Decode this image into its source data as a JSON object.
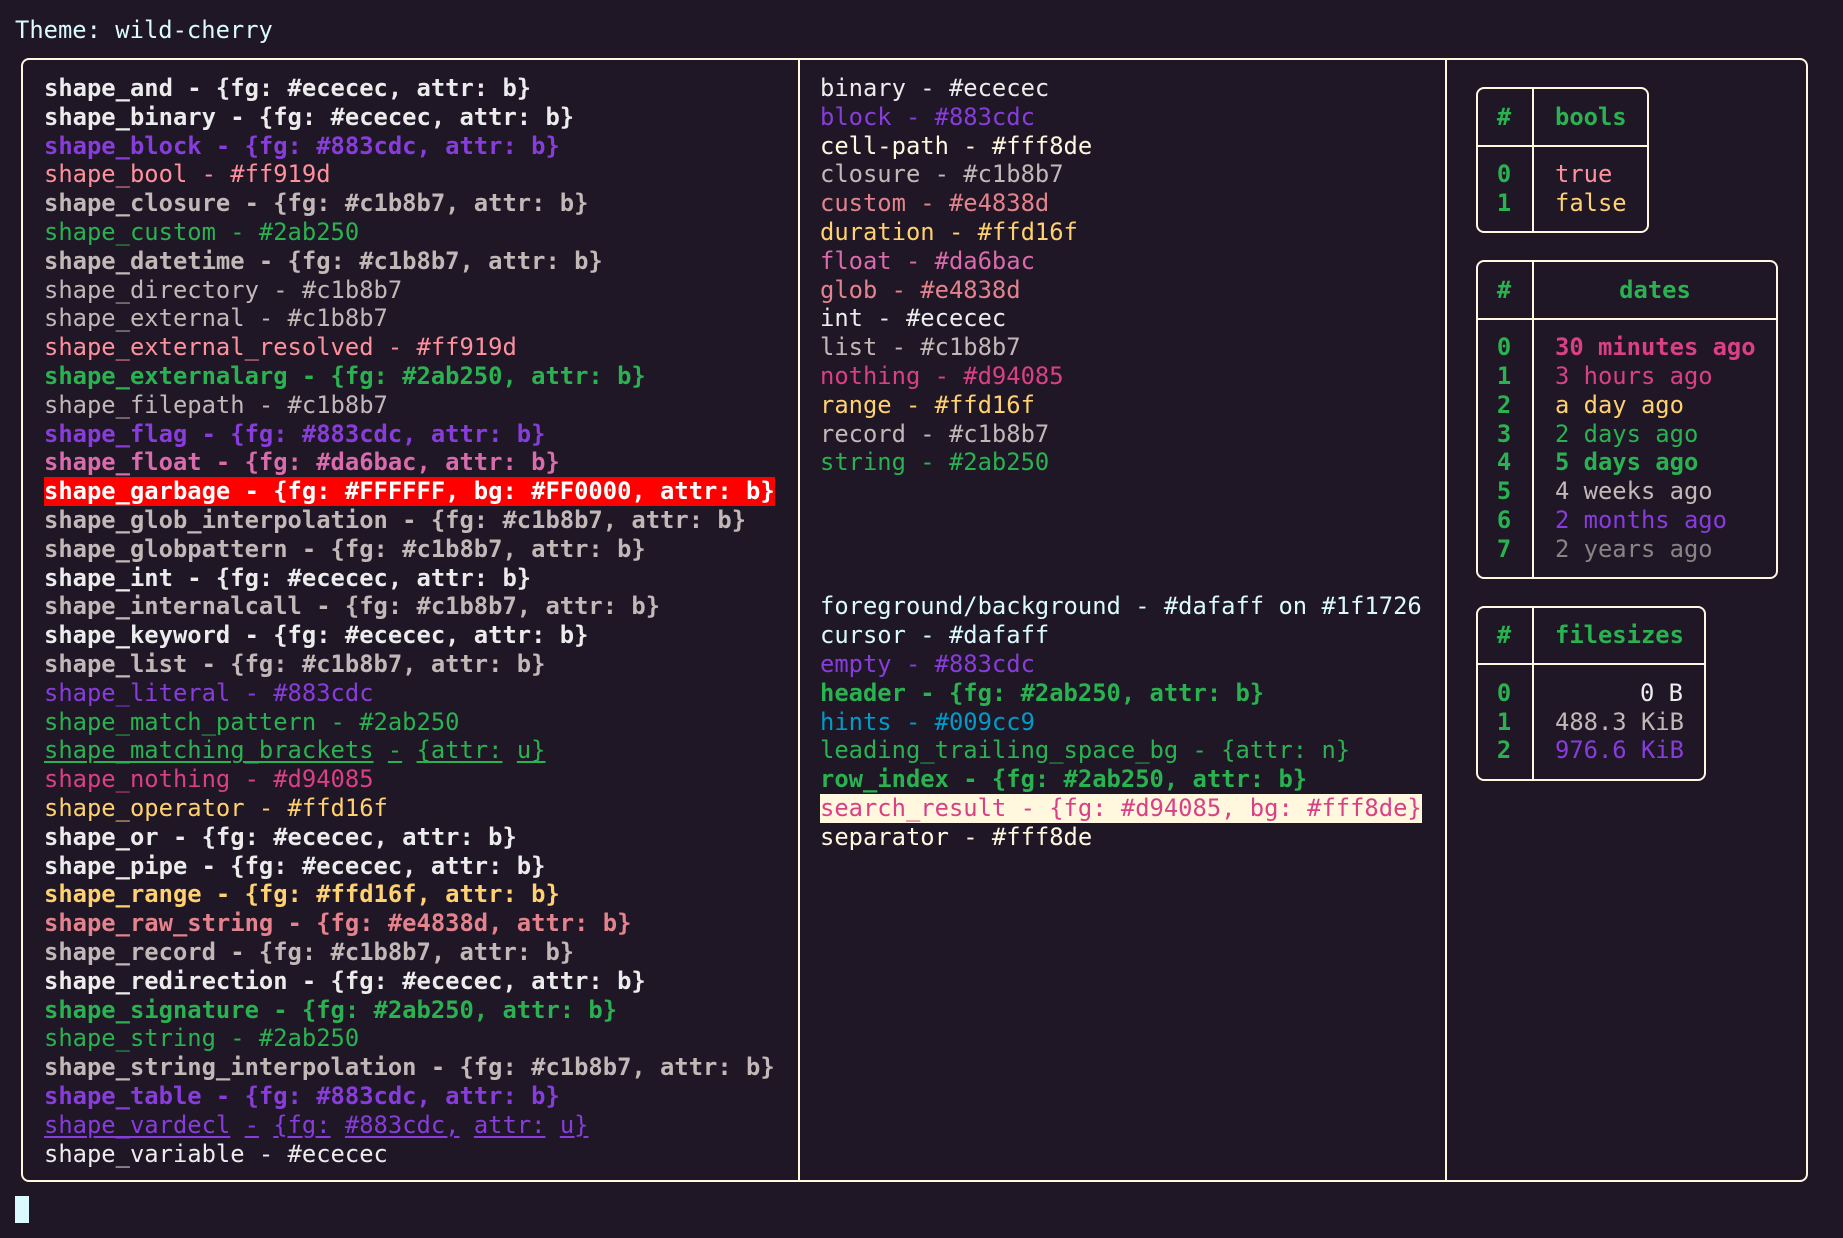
{
  "title": "Theme: wild-cherry",
  "colors": {
    "background": "#1f1726",
    "foreground": "#dafaff",
    "border": "#fff8de",
    "cursor": "#dafaff"
  },
  "shapes": [
    {
      "text": "shape_and - {fg: #ececec, attr: b}",
      "fg": "#ececec",
      "bold": true
    },
    {
      "text": "shape_binary - {fg: #ececec, attr: b}",
      "fg": "#ececec",
      "bold": true
    },
    {
      "text": "shape_block - {fg: #883cdc, attr: b}",
      "fg": "#883cdc",
      "bold": true
    },
    {
      "text": "shape_bool - #ff919d",
      "fg": "#ff919d"
    },
    {
      "text": "shape_closure - {fg: #c1b8b7, attr: b}",
      "fg": "#c1b8b7",
      "bold": true
    },
    {
      "text": "shape_custom - #2ab250",
      "fg": "#2ab250"
    },
    {
      "text": "shape_datetime - {fg: #c1b8b7, attr: b}",
      "fg": "#c1b8b7",
      "bold": true
    },
    {
      "text": "shape_directory - #c1b8b7",
      "fg": "#c1b8b7"
    },
    {
      "text": "shape_external - #c1b8b7",
      "fg": "#c1b8b7"
    },
    {
      "text": "shape_external_resolved - #ff919d",
      "fg": "#ff919d"
    },
    {
      "text": "shape_externalarg - {fg: #2ab250, attr: b}",
      "fg": "#2ab250",
      "bold": true
    },
    {
      "text": "shape_filepath - #c1b8b7",
      "fg": "#c1b8b7"
    },
    {
      "text": "shape_flag - {fg: #883cdc, attr: b}",
      "fg": "#883cdc",
      "bold": true
    },
    {
      "text": "shape_float - {fg: #da6bac, attr: b}",
      "fg": "#da6bac",
      "bold": true
    },
    {
      "text": "shape_garbage - {fg: #FFFFFF, bg: #FF0000, attr: b}",
      "fg": "#FFFFFF",
      "bg": "#FF0000",
      "bold": true
    },
    {
      "text": "shape_glob_interpolation - {fg: #c1b8b7, attr: b}",
      "fg": "#c1b8b7",
      "bold": true
    },
    {
      "text": "shape_globpattern - {fg: #c1b8b7, attr: b}",
      "fg": "#c1b8b7",
      "bold": true
    },
    {
      "text": "shape_int - {fg: #ececec, attr: b}",
      "fg": "#ececec",
      "bold": true
    },
    {
      "text": "shape_internalcall - {fg: #c1b8b7, attr: b}",
      "fg": "#c1b8b7",
      "bold": true
    },
    {
      "text": "shape_keyword - {fg: #ececec, attr: b}",
      "fg": "#ececec",
      "bold": true
    },
    {
      "text": "shape_list - {fg: #c1b8b7, attr: b}",
      "fg": "#c1b8b7",
      "bold": true
    },
    {
      "text": "shape_literal - #883cdc",
      "fg": "#883cdc"
    },
    {
      "text": "shape_match_pattern - #2ab250",
      "fg": "#2ab250"
    },
    {
      "text": "shape_matching_brackets - {attr: u}",
      "fg": "#2ab250",
      "underline": true
    },
    {
      "text": "shape_nothing - #d94085",
      "fg": "#d94085"
    },
    {
      "text": "shape_operator - #ffd16f",
      "fg": "#ffd16f"
    },
    {
      "text": "shape_or - {fg: #ececec, attr: b}",
      "fg": "#ececec",
      "bold": true
    },
    {
      "text": "shape_pipe - {fg: #ececec, attr: b}",
      "fg": "#ececec",
      "bold": true
    },
    {
      "text": "shape_range - {fg: #ffd16f, attr: b}",
      "fg": "#ffd16f",
      "bold": true
    },
    {
      "text": "shape_raw_string - {fg: #e4838d, attr: b}",
      "fg": "#e4838d",
      "bold": true
    },
    {
      "text": "shape_record - {fg: #c1b8b7, attr: b}",
      "fg": "#c1b8b7",
      "bold": true
    },
    {
      "text": "shape_redirection - {fg: #ececec, attr: b}",
      "fg": "#ececec",
      "bold": true
    },
    {
      "text": "shape_signature - {fg: #2ab250, attr: b}",
      "fg": "#2ab250",
      "bold": true
    },
    {
      "text": "shape_string - #2ab250",
      "fg": "#2ab250"
    },
    {
      "text": "shape_string_interpolation - {fg: #c1b8b7, attr: b}",
      "fg": "#c1b8b7",
      "bold": true
    },
    {
      "text": "shape_table - {fg: #883cdc, attr: b}",
      "fg": "#883cdc",
      "bold": true
    },
    {
      "text": "shape_vardecl - {fg: #883cdc, attr: u}",
      "fg": "#883cdc",
      "underline": true
    },
    {
      "text": "shape_variable - #ececec",
      "fg": "#ececec"
    }
  ],
  "types": [
    {
      "text": "binary - #ececec",
      "fg": "#ececec"
    },
    {
      "text": "block - #883cdc",
      "fg": "#883cdc"
    },
    {
      "text": "cell-path - #fff8de",
      "fg": "#fff8de"
    },
    {
      "text": "closure - #c1b8b7",
      "fg": "#c1b8b7"
    },
    {
      "text": "custom - #e4838d",
      "fg": "#e4838d"
    },
    {
      "text": "duration - #ffd16f",
      "fg": "#ffd16f"
    },
    {
      "text": "float - #da6bac",
      "fg": "#da6bac"
    },
    {
      "text": "glob - #e4838d",
      "fg": "#e4838d"
    },
    {
      "text": "int - #ececec",
      "fg": "#ececec"
    },
    {
      "text": "list - #c1b8b7",
      "fg": "#c1b8b7"
    },
    {
      "text": "nothing - #d94085",
      "fg": "#d94085"
    },
    {
      "text": "range - #ffd16f",
      "fg": "#ffd16f"
    },
    {
      "text": "record - #c1b8b7",
      "fg": "#c1b8b7"
    },
    {
      "text": "string - #2ab250",
      "fg": "#2ab250"
    }
  ],
  "ui": [
    {
      "text": "foreground/background - #dafaff on #1f1726",
      "fg": "#dafaff"
    },
    {
      "text": "cursor - #dafaff",
      "fg": "#dafaff"
    },
    {
      "text": "empty - #883cdc",
      "fg": "#883cdc"
    },
    {
      "text": "header - {fg: #2ab250, attr: b}",
      "fg": "#2ab250",
      "bold": true
    },
    {
      "text": "hints - #009cc9",
      "fg": "#009cc9"
    },
    {
      "text": "leading_trailing_space_bg - {attr: n}",
      "fg": "#2ab250"
    },
    {
      "text": "row_index - {fg: #2ab250, attr: b}",
      "fg": "#2ab250",
      "bold": true
    },
    {
      "text": "search_result - {fg: #d94085, bg: #fff8de}",
      "fg": "#d94085",
      "bg": "#fff8de"
    },
    {
      "text": "separator - #fff8de",
      "fg": "#fff8de"
    }
  ],
  "tables": {
    "bools": {
      "index_header": "#",
      "header": "bools",
      "rows": [
        {
          "index": "0",
          "value": "true",
          "fg": "#ff919d"
        },
        {
          "index": "1",
          "value": "false",
          "fg": "#ffd16f"
        }
      ]
    },
    "dates": {
      "index_header": "#",
      "header": "dates",
      "rows": [
        {
          "index": "0",
          "value": "30 minutes ago",
          "fg": "#d94085",
          "bold": true
        },
        {
          "index": "1",
          "value": "3 hours ago",
          "fg": "#d94085"
        },
        {
          "index": "2",
          "value": "a day ago",
          "fg": "#ffd16f"
        },
        {
          "index": "3",
          "value": "2 days ago",
          "fg": "#2ab250"
        },
        {
          "index": "4",
          "value": "5 days ago",
          "fg": "#2ab250",
          "bold": true
        },
        {
          "index": "5",
          "value": "4 weeks ago",
          "fg": "#c1b8b7"
        },
        {
          "index": "6",
          "value": "2 months ago",
          "fg": "#883cdc"
        },
        {
          "index": "7",
          "value": "2 years ago",
          "fg": "#8b8485"
        }
      ]
    },
    "filesizes": {
      "index_header": "#",
      "header": "filesizes",
      "rows": [
        {
          "index": "0",
          "value": "0 B",
          "fg": "#ececec"
        },
        {
          "index": "1",
          "value": "488.3 KiB",
          "fg": "#c1b8b7"
        },
        {
          "index": "2",
          "value": "976.6 KiB",
          "fg": "#883cdc"
        }
      ]
    }
  }
}
